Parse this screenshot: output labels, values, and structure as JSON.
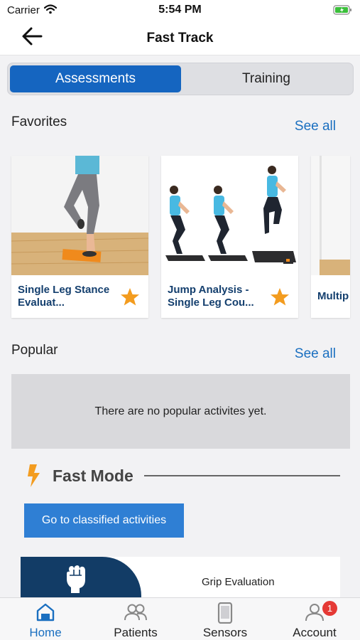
{
  "status_bar": {
    "carrier": "Carrier",
    "time": "5:54 PM"
  },
  "nav": {
    "title": "Fast Track"
  },
  "segments": [
    {
      "label": "Assessments",
      "active": true
    },
    {
      "label": "Training",
      "active": false
    }
  ],
  "favorites": {
    "title": "Favorites",
    "see_all": "See all",
    "cards": [
      {
        "title": "Single Leg Stance Evaluat...",
        "favorited": true
      },
      {
        "title": "Jump Analysis - Single Leg Cou...",
        "favorited": true
      },
      {
        "title": "Multip",
        "favorited": false
      }
    ]
  },
  "popular": {
    "title": "Popular",
    "see_all": "See all",
    "empty_message": "There are no popular activites yet."
  },
  "fast_mode": {
    "title": "Fast Mode",
    "button_label": "Go to classified activities",
    "activities": [
      {
        "label": "Grip Evaluation",
        "icon": "fist-icon"
      }
    ]
  },
  "tab_bar": {
    "tabs": [
      {
        "label": "Home",
        "icon": "home-icon",
        "active": true
      },
      {
        "label": "Patients",
        "icon": "patients-icon",
        "active": false
      },
      {
        "label": "Sensors",
        "icon": "sensor-icon",
        "active": false
      },
      {
        "label": "Account",
        "icon": "account-icon",
        "active": false,
        "badge": "1"
      }
    ]
  },
  "colors": {
    "accent": "#1565c0",
    "link": "#1a6fc0",
    "star": "#f39c1f",
    "bolt": "#f39c1f",
    "badge": "#e53935",
    "grip_badge": "#123c66"
  }
}
